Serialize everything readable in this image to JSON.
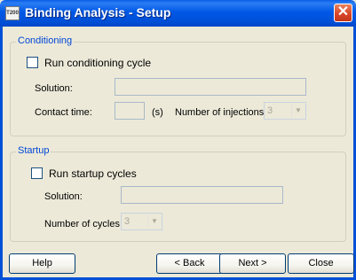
{
  "window": {
    "icon_text": "T200",
    "title": "Binding Analysis - Setup",
    "close_glyph": "✕"
  },
  "conditioning": {
    "legend": "Conditioning",
    "run_label": "Run conditioning cycle",
    "solution_label": "Solution:",
    "solution_value": "",
    "contact_time_label": "Contact time:",
    "contact_time_value": "",
    "contact_time_unit": "(s)",
    "injections_label": "Number of injections:",
    "injections_value": "3"
  },
  "startup": {
    "legend": "Startup",
    "run_label": "Run startup cycles",
    "solution_label": "Solution:",
    "solution_value": "",
    "cycles_label": "Number of cycles:",
    "cycles_value": "3"
  },
  "buttons": {
    "help": "Help",
    "back": "< Back",
    "next": "Next >",
    "close": "Close"
  },
  "icons": {
    "dropdown": "chevron-down-icon",
    "close": "close-icon"
  },
  "colors": {
    "titlebar": "#0054e3",
    "legend_text": "#0046d5",
    "disabled_text": "#aca899",
    "close_button": "#d8452a"
  }
}
